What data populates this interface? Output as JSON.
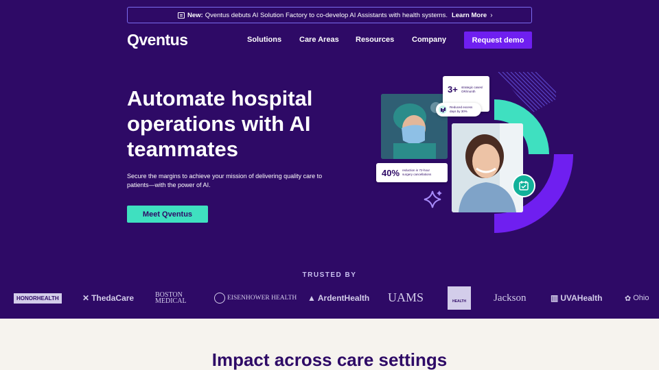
{
  "announcement": {
    "badge": "New:",
    "text": "Qventus debuts AI Solution Factory to co-develop AI Assistants with health systems.",
    "link": "Learn More"
  },
  "nav": {
    "logo": "Qventus",
    "items": [
      "Solutions",
      "Care Areas",
      "Resources",
      "Company"
    ],
    "demo_label": "Request demo"
  },
  "hero": {
    "headline_lines": [
      "Automate hospital",
      "operations with AI",
      "teammates"
    ],
    "subtext_lines": [
      "Secure the margins to achieve your mission of delivering quality care to",
      "patients—with the power of AI."
    ],
    "cta_label": "Meet Qventus",
    "stats": {
      "cases_value": "3+",
      "cases_label_1": "strategic cases/",
      "cases_label_2": "OR/month",
      "excess_label_1": "Reduced excess",
      "excess_label_2": "days by 30%",
      "cancel_value": "40%",
      "cancel_label_1": "reduction in 72-hour",
      "cancel_label_2": "surgery cancellations"
    }
  },
  "trusted": {
    "title": "TRUSTED BY",
    "logos": [
      "HONORHEALTH",
      "ThedaCare",
      "BOSTON MEDICAL",
      "EISENHOWER HEALTH",
      "ArdentHealth",
      "UAMS",
      "HEALTH",
      "Jackson",
      "UVAHealth",
      "Ohio"
    ]
  },
  "impact": {
    "title": "Impact across care settings"
  },
  "colors": {
    "hero_bg": "#2e0a66",
    "accent_purple": "#6f1ff0",
    "accent_teal": "#3fe0c0",
    "page_bg": "#f6f3ee"
  },
  "icons": [
    "newspaper-icon",
    "chevron-right-icon",
    "chart-icon",
    "calendar-check-icon",
    "sparkle-icon"
  ]
}
